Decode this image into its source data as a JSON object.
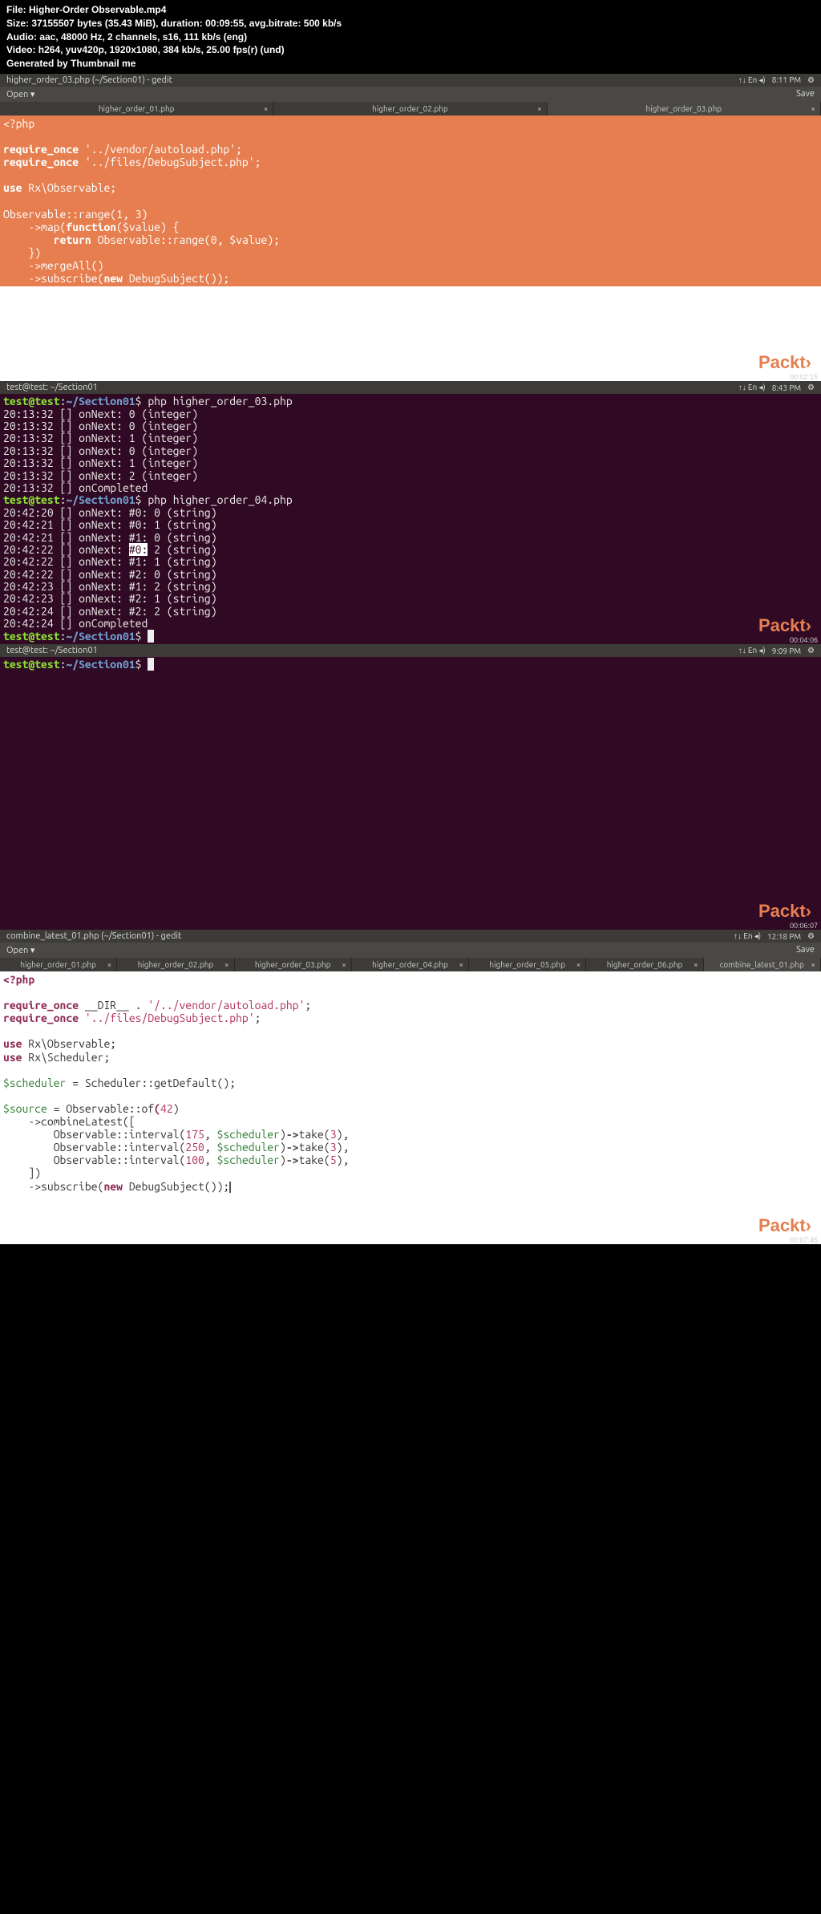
{
  "file_header": {
    "file": "File: Higher-Order Observable.mp4",
    "size": "Size: 37155507 bytes (35.43 MiB), duration: 00:09:55, avg.bitrate: 500 kb/s",
    "audio": "Audio: aac, 48000 Hz, 2 channels, s16, 111 kb/s (eng)",
    "video": "Video: h264, yuv420p, 1920x1080, 384 kb/s, 25.00 fps(r) (und)",
    "gen": "Generated by Thumbnail me"
  },
  "watermark": "Packt›",
  "panel1": {
    "title": "higher_order_03.php (~/Section01) - gedit",
    "time": "8:11 PM",
    "toolbar_open": "Open ▾",
    "toolbar_save": "Save",
    "tabs": [
      "higher_order_01.php",
      "higher_order_02.php",
      "higher_order_03.php"
    ],
    "active_tab": 2,
    "code": {
      "l1": "<?php",
      "l2": "",
      "l3a": "require_once",
      "l3b": " '../vendor/autoload.php';",
      "l4a": "require_once",
      "l4b": " '../files/DebugSubject.php';",
      "l5": "",
      "l6a": "use",
      "l6b": " Rx\\Observable;",
      "l7": "",
      "l8": "Observable::range(1, 3)",
      "l9a": "    ->map(",
      "l9b": "function",
      "l9c": "($value) {",
      "l10a": "        ",
      "l10b": "return",
      "l10c": " Observable::range(0, $value);",
      "l11": "    })",
      "l12": "    ->mergeAll()",
      "l13a": "    ->subscribe(",
      "l13b": "new",
      "l13c": " DebugSubject());"
    },
    "ts_small": "00:02:15"
  },
  "panel2": {
    "title": "test@test: ~/Section01",
    "time": "8:43 PM",
    "prompt_user": "test@test",
    "prompt_path": "~/Section01",
    "cmd1": "php higher_order_03.php",
    "out1": [
      "20:13:32 [] onNext: 0 (integer)",
      "20:13:32 [] onNext: 0 (integer)",
      "20:13:32 [] onNext: 1 (integer)",
      "20:13:32 [] onNext: 0 (integer)",
      "20:13:32 [] onNext: 1 (integer)",
      "20:13:32 [] onNext: 2 (integer)",
      "20:13:32 [] onCompleted"
    ],
    "cmd2": "php higher_order_04.php",
    "out2_a": "20:42:20 [] onNext: #0: 0 (string)",
    "out2_b": "20:42:21 [] onNext: #0: 1 (string)",
    "out2_c": "20:42:21 [] onNext: #1: 0 (string)",
    "out2_d_pre": "20:42:22 [] onNext: ",
    "out2_d_hl": "#0:",
    "out2_d_post": " 2 (string)",
    "out2_e": "20:42:22 [] onNext: #1: 1 (string)",
    "out2_f": "20:42:22 [] onNext: #2: 0 (string)",
    "out2_g": "20:42:23 [] onNext: #1: 2 (string)",
    "out2_h": "20:42:23 [] onNext: #2: 1 (string)",
    "out2_i": "20:42:24 [] onNext: #2: 2 (string)",
    "out2_j": "20:42:24 [] onCompleted",
    "ts_small": "00:04:06"
  },
  "panel3": {
    "title": "test@test: ~/Section01",
    "time": "9:09 PM",
    "prompt_user": "test@test",
    "prompt_path": "~/Section01",
    "ts_small": "00:06:07"
  },
  "panel4": {
    "title": "combine_latest_01.php (~/Section01) - gedit",
    "time": "12:18 PM",
    "toolbar_open": "Open ▾",
    "toolbar_save": "Save",
    "tabs": [
      "higher_order_01.php",
      "higher_order_02.php",
      "higher_order_03.php",
      "higher_order_04.php",
      "higher_order_05.php",
      "higher_order_06.php",
      "combine_latest_01.php"
    ],
    "active_tab": 6,
    "code": {
      "l1": "<?php",
      "l2": "",
      "l3_kw": "require_once",
      "l3_mid": " __DIR__ . ",
      "l3_str": "'/../vendor/autoload.php'",
      "l3_end": ";",
      "l4_kw": "require_once",
      "l4_str": " '../files/DebugSubject.php'",
      "l4_end": ";",
      "l5": "",
      "l6_kw": "use",
      "l6_rest": " Rx\\Observable;",
      "l7_kw": "use",
      "l7_rest": " Rx\\Scheduler;",
      "l8": "",
      "l9_var": "$scheduler",
      "l9_mid": " = Scheduler::getDefault();",
      "l10": "",
      "l11_var": "$source",
      "l11_mid": " = Observable::of",
      "l11_paren": "(",
      "l11_num": "42",
      "l11_end": ")",
      "l12": "    ->combineLatest([",
      "l13a": "        Observable::interval(",
      "l13n1": "175",
      "l13m": ", ",
      "l13v": "$scheduler",
      "l13b": ")",
      "l13ar": "->",
      "l13c": "take(",
      "l13n2": "3",
      "l13d": "),",
      "l14a": "        Observable::interval(",
      "l14n1": "250",
      "l14m": ", ",
      "l14v": "$scheduler",
      "l14b": ")",
      "l14ar": "->",
      "l14c": "take(",
      "l14n2": "3",
      "l14d": "),",
      "l15a": "        Observable::interval(",
      "l15n1": "100",
      "l15m": ", ",
      "l15v": "$scheduler",
      "l15b": ")",
      "l15ar": "->",
      "l15c": "take(",
      "l15n2": "5",
      "l15d": "),",
      "l16": "    ])",
      "l17a": "    ->subscribe(",
      "l17b": "new",
      "l17c": " DebugSubject());"
    },
    "ts_small": "00:07:45"
  },
  "tray_icons": "↑↓  En  ◂)"
}
